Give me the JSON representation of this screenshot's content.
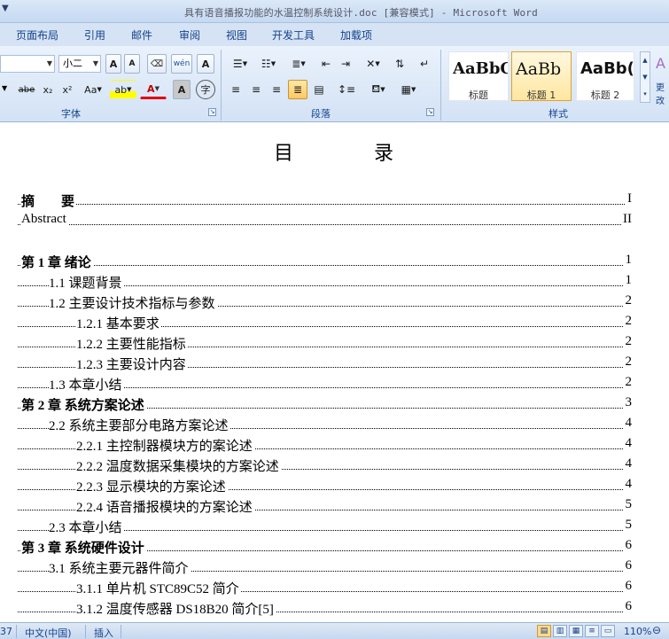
{
  "window": {
    "title": "具有语音播报功能的水温控制系统设计.doc [兼容模式] - Microsoft Word"
  },
  "tabs": [
    "页面布局",
    "引用",
    "邮件",
    "审阅",
    "视图",
    "开发工具",
    "加载项"
  ],
  "ribbon": {
    "font_group": {
      "label": "字体",
      "font_size": "小二",
      "grow_label": "A",
      "shrink_label": "A",
      "phonetic_label": "wén",
      "charborder_label": "A",
      "strike_label": "abe",
      "sub_label": "x₂",
      "sup_label": "x²",
      "case_label": "Aa",
      "highlight_label": "ab",
      "fontcolor_label": "A",
      "shading_label": "A",
      "enclose_label": "字"
    },
    "paragraph_group": {
      "label": "段落"
    },
    "styles_group": {
      "label": "样式",
      "styles": [
        {
          "sample": "AaBbC",
          "name": "标题"
        },
        {
          "sample": "AaBb",
          "name": "标题 1"
        },
        {
          "sample": "AaBb(",
          "name": "标题 2"
        }
      ],
      "change_styles_label": "更改"
    }
  },
  "document": {
    "title": "目 录",
    "toc": [
      {
        "text": "摘　　要",
        "page": "I",
        "level": "front"
      },
      {
        "text": "Abstract",
        "page": "II",
        "level": "front-plain"
      },
      {
        "text": "第 1 章  绪论",
        "page": "1",
        "level": "chap"
      },
      {
        "text": "1.1   课题背景",
        "page": "1",
        "level": "1"
      },
      {
        "text": "1.2   主要设计技术指标与参数",
        "page": "2",
        "level": "1"
      },
      {
        "text": "1.2.1 基本要求",
        "page": "2",
        "level": "2"
      },
      {
        "text": "1.2.2  主要性能指标",
        "page": "2",
        "level": "2"
      },
      {
        "text": "1.2.3  主要设计内容",
        "page": "2",
        "level": "2"
      },
      {
        "text": "1.3  本章小结",
        "page": "2",
        "level": "1"
      },
      {
        "text": "第 2 章  系统方案论述",
        "page": "3",
        "level": "chap"
      },
      {
        "text": "2.2  系统主要部分电路方案论述",
        "page": "4",
        "level": "1"
      },
      {
        "text": "2.2.1  主控制器模块方的案论述",
        "page": "4",
        "level": "2"
      },
      {
        "text": "2.2.2  温度数据采集模块的方案论述",
        "page": "4",
        "level": "2"
      },
      {
        "text": "2.2.3  显示模块的方案论述",
        "page": "4",
        "level": "2"
      },
      {
        "text": "2.2.4 语音播报模块的方案论述",
        "page": "5",
        "level": "2"
      },
      {
        "text": "2.3  本章小结",
        "page": "5",
        "level": "1"
      },
      {
        "text": "第 3 章  系统硬件设计",
        "page": "6",
        "level": "chap"
      },
      {
        "text": "3.1    系统主要元器件简介",
        "page": "6",
        "level": "1"
      },
      {
        "text": "3.1.1    单片机 STC89C52 简介",
        "page": "6",
        "level": "2"
      },
      {
        "text": "3.1.2    温度传感器 DS18B20 简介[5]",
        "page": "6",
        "level": "2"
      }
    ]
  },
  "statusbar": {
    "page_count": "37",
    "language": "中文(中国)",
    "insert_mode": "插入",
    "zoom": "110%"
  }
}
